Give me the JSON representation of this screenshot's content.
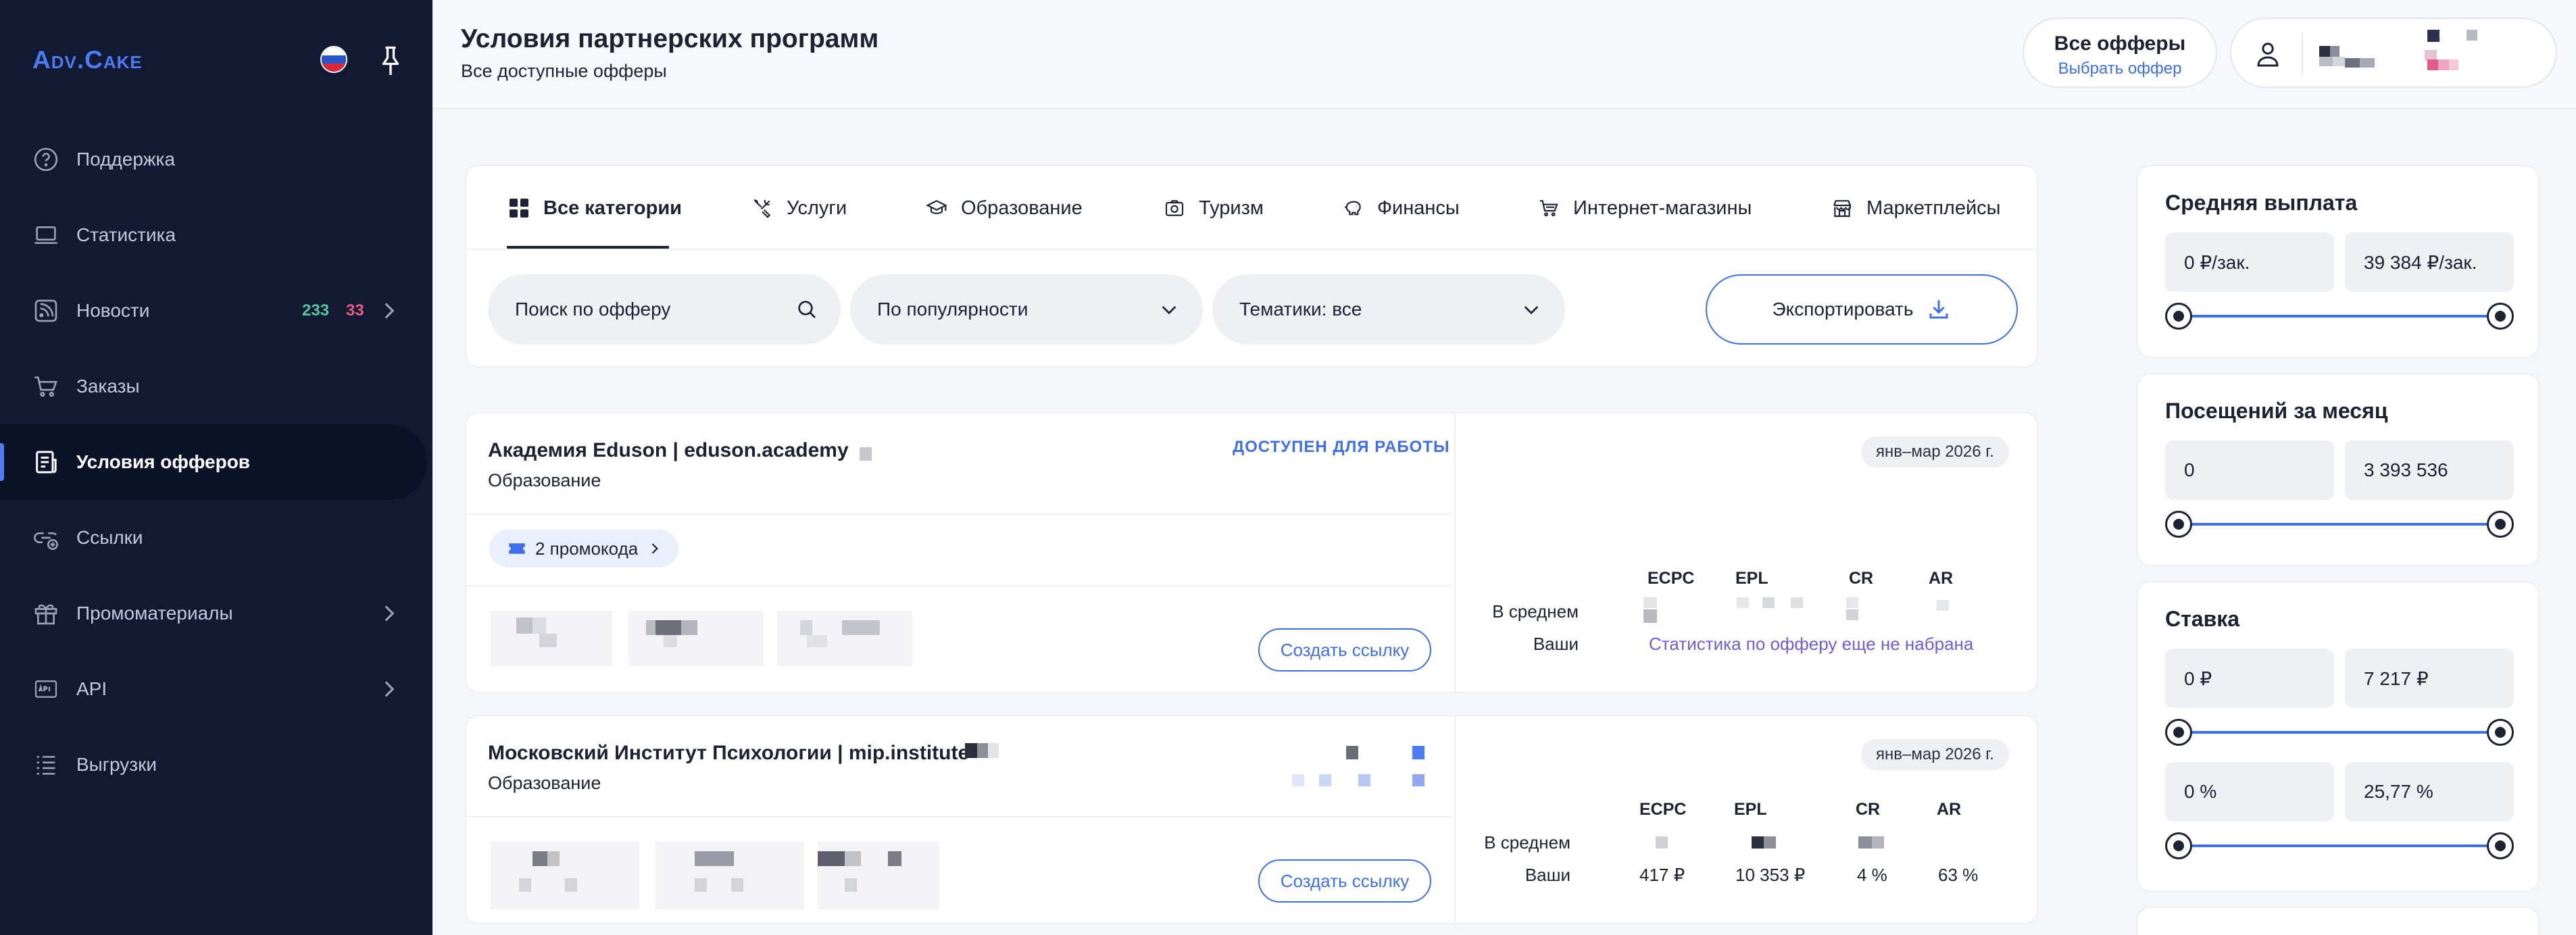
{
  "sidebar": {
    "logo": "Adv.Cake",
    "items": [
      {
        "label": "Поддержка",
        "icon": "help-circle-icon"
      },
      {
        "label": "Статистика",
        "icon": "laptop-icon"
      },
      {
        "label": "Новости",
        "icon": "rss-icon",
        "badge_new": "233",
        "badge_alert": "33",
        "has_submenu": true
      },
      {
        "label": "Заказы",
        "icon": "cart-icon"
      },
      {
        "label": "Условия офферов",
        "icon": "terms-icon",
        "active": true
      },
      {
        "label": "Ссылки",
        "icon": "link-add-icon"
      },
      {
        "label": "Промоматериалы",
        "icon": "gift-icon",
        "has_submenu": true
      },
      {
        "label": "API",
        "icon": "api-icon",
        "has_submenu": true
      },
      {
        "label": "Выгрузки",
        "icon": "list-export-icon"
      }
    ]
  },
  "header": {
    "title": "Условия партнерских программ",
    "subtitle": "Все доступные офферы",
    "offer_switch": {
      "title": "Все офферы",
      "action": "Выбрать оффер"
    }
  },
  "tabs": [
    {
      "label": "Все категории",
      "icon": "grid-icon",
      "active": true
    },
    {
      "label": "Услуги",
      "icon": "tools-icon"
    },
    {
      "label": "Образование",
      "icon": "graduation-cap-icon"
    },
    {
      "label": "Туризм",
      "icon": "camera-icon"
    },
    {
      "label": "Финансы",
      "icon": "piggy-bank-icon"
    },
    {
      "label": "Интернет-магазины",
      "icon": "shopping-cart-icon"
    },
    {
      "label": "Маркетплейсы",
      "icon": "store-icon"
    }
  ],
  "filters": {
    "search_placeholder": "Поиск по офферу",
    "sort_value": "По популярности",
    "topic_value": "Тематики: все",
    "export_label": "Экспортировать"
  },
  "offers": [
    {
      "name": "Академия Eduson | eduson.academy",
      "category": "Образование",
      "status": "ДОСТУПЕН ДЛЯ РАБОТЫ",
      "promo_label": "2 промокода",
      "period": "янв–мар 2026 г.",
      "link_button": "Создать ссылку",
      "metric_headers": [
        "ECPC",
        "EPL",
        "CR",
        "AR"
      ],
      "row_avg_label": "В среднем",
      "row_yours_label": "Ваши",
      "yours_note": "Статистика по офферу еще не набрана"
    },
    {
      "name": "Московский Институт Психологии | mip.institute",
      "category": "Образование",
      "period": "янв–мар 2026 г.",
      "link_button": "Создать ссылку",
      "metric_headers": [
        "ECPC",
        "EPL",
        "CR",
        "AR"
      ],
      "row_avg_label": "В среднем",
      "row_yours_label": "Ваши",
      "yours_values": [
        "417 ₽",
        "10 353 ₽",
        "4 %",
        "63 %"
      ]
    }
  ],
  "side_filters": {
    "payout": {
      "title": "Средняя выплата",
      "min": "0 ₽/зак.",
      "max": "39 384 ₽/зак."
    },
    "visits": {
      "title": "Посещений за месяц",
      "min": "0",
      "max": "3 393 536"
    },
    "rate": {
      "title": "Ставка",
      "min": "0 ₽",
      "max": "7 217 ₽",
      "min_pct": "0 %",
      "max_pct": "25,77 %"
    }
  },
  "colors": {
    "sidebar_bg": "#121a33",
    "accent": "#3f6fe8",
    "badge_green": "#54c79a",
    "badge_red": "#ea5d7c"
  }
}
